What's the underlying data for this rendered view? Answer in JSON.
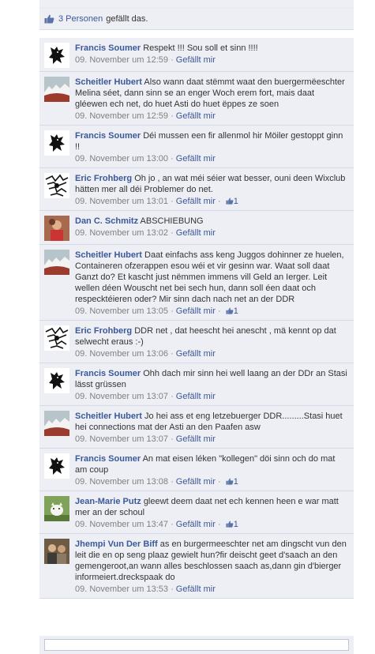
{
  "likes_bar": {
    "count_text": "3 Personen",
    "suffix": "gefällt das."
  },
  "comments": [
    {
      "author": "Francis Soumer",
      "avatar": "lion-crest",
      "text": "Respekt !!! Sou soll et sinn !!!!",
      "time": "09. November um 12:59",
      "like": "Gefällt mir",
      "likes": ""
    },
    {
      "author": "Scheitler Hubert",
      "avatar": "landscape",
      "text": "Also wann daat stëmmt waat den buergermëeschter Melina séet, dann sinn se an enger Woch erem fort, mais daat gléewen ech net, do huet Asti do huet ëppes ze soen",
      "time": "09. November um 12:59",
      "like": "Gefällt mir",
      "likes": ""
    },
    {
      "author": "Francis Soumer",
      "avatar": "lion-crest",
      "text": "Déi mussen een fir allenmol hir Möiler gestoppt ginn !!",
      "time": "09. November um 13:00",
      "like": "Gefällt mir",
      "likes": ""
    },
    {
      "author": "Eric Frohberg",
      "avatar": "sketch",
      "text": "Oh jo , an wat méi séier wat besser, ouni deen Wixclub hätten mer all déi Problemer do net.",
      "time": "09. November um 13:01",
      "like": "Gefällt mir",
      "likes": "1"
    },
    {
      "author": "Dan C. Schmitz",
      "avatar": "person-red",
      "text": "ABSCHIEBUNG",
      "time": "09. November um 13:02",
      "like": "Gefällt mir",
      "likes": ""
    },
    {
      "author": "Scheitler Hubert",
      "avatar": "landscape",
      "text": "Daat einfachs ass keng Juggos dohinner ze huelen, Containeren ofzerappen esou wéi et vir gesinn war. Waat soll daat Ganzt do? Et kascht just nëmmen immens vill Geld an Ierger. Leit wellen déen Wouscht net bei sech hun, dann soll éen daat och respecktéieren oder? Mir sinn dach nach net an der DDR",
      "time": "09. November um 13:05",
      "like": "Gefällt mir",
      "likes": "1"
    },
    {
      "author": "Eric Frohberg",
      "avatar": "sketch",
      "text": "DDR net , dat heescht hei anescht , mä kennt op dat selwecht eraus :-)",
      "time": "09. November um 13:06",
      "like": "Gefällt mir",
      "likes": ""
    },
    {
      "author": "Francis Soumer",
      "avatar": "lion-crest",
      "text": "Ohh dach mir sinn hei well laang an der DDr an Stasi lässt grüssen",
      "time": "09. November um 13:07",
      "like": "Gefällt mir",
      "likes": ""
    },
    {
      "author": "Scheitler Hubert",
      "avatar": "landscape",
      "text": "Jo hei ass et eng letzebuerger DDR.........Stasi huet hei connections mat der Asti an den Paafen asw",
      "time": "09. November um 13:07",
      "like": "Gefällt mir",
      "likes": ""
    },
    {
      "author": "Francis Soumer",
      "avatar": "lion-crest",
      "text": "An mat eisen léken \"kollegen\" döi sinn och do mat am coup",
      "time": "09. November um 13:08",
      "like": "Gefällt mir",
      "likes": "1"
    },
    {
      "author": "Jean-Marie Putz",
      "avatar": "dog",
      "text": "gleewt deem daat net ech kennen heen e war matt mer an der schoul",
      "time": "09. November um 13:47",
      "like": "Gefällt mir",
      "likes": "1"
    },
    {
      "author": "Jhempi Vun Der Biff",
      "avatar": "person-group",
      "text": "as en burgermeeschter net am dingscht vun den leit die en op seng plaaz gewielt hun?fir deischt geet d'saach an den gemengeroot,an wann alles beschlossen saach as,dann gin d'bierger informeiert.dreckspaak do",
      "time": "09. November um 13:53",
      "like": "Gefällt mir",
      "likes": ""
    }
  ],
  "colors": {
    "link": "#3b5998",
    "comment_bg": "#edeff4",
    "meta": "#808080"
  }
}
